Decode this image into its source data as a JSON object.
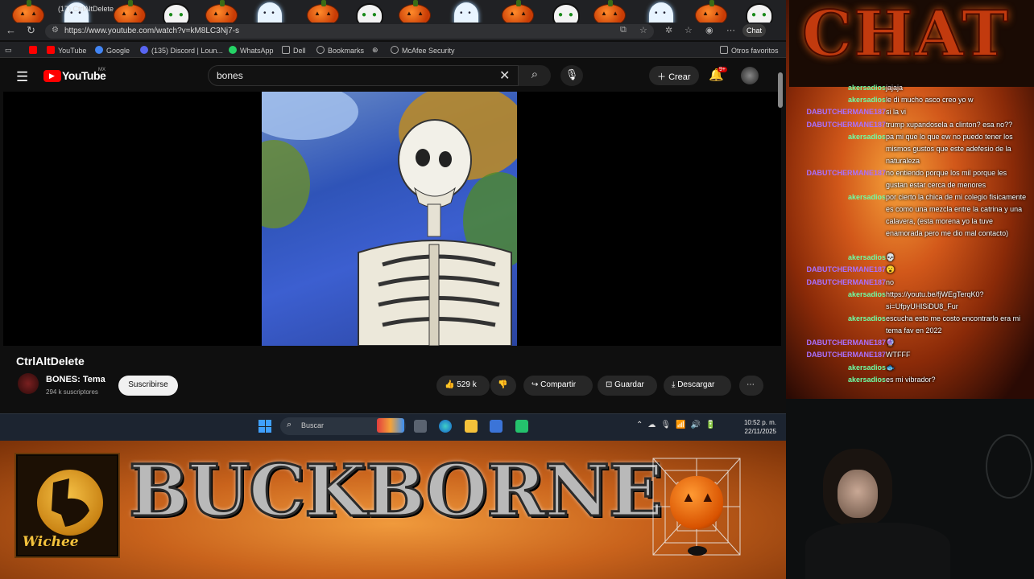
{
  "browser": {
    "tab_title": "(17) CtrlAltDelete",
    "url": "https://www.youtube.com/watch?v=kM8LC3Nj7-s",
    "chat_button": "Chat",
    "bookmarks": [
      {
        "label": "YouTube",
        "color": "#ff0000"
      },
      {
        "label": "Google",
        "color": "#4285f4"
      },
      {
        "label": "(135) Discord | Loun...",
        "color": "#5865f2"
      },
      {
        "label": "WhatsApp",
        "color": "#25d366"
      },
      {
        "label": "Dell",
        "color": "#888888"
      },
      {
        "label": "Bookmarks",
        "color": "#888888"
      },
      {
        "label": "McAfee Security",
        "color": "#888888"
      }
    ],
    "other_favorites": "Otros favoritos"
  },
  "youtube": {
    "logo_text": "YouTube",
    "region": "MX",
    "search_value": "bones",
    "create_label": "Crear",
    "notif_count": "9+",
    "video_title": "CtrlAltDelete",
    "channel_name": "BONES: Tema",
    "channel_subs": "294 k suscriptores",
    "subscribe_label": "Suscribirse",
    "likes": "529 k",
    "share_label": "Compartir",
    "save_label": "Guardar",
    "download_label": "Descargar"
  },
  "taskbar": {
    "search_placeholder": "Buscar",
    "time": "10:52 p. m.",
    "date": "22/11/2025"
  },
  "banner": {
    "logo_label": "Wichee",
    "title": "BUCKBORNE"
  },
  "chat": {
    "header": "CHAT",
    "messages": [
      {
        "user": "akersadios",
        "text": "jajaja",
        "color": "green"
      },
      {
        "user": "akersadios",
        "text": "le di mucho asco creo yo w",
        "color": "green"
      },
      {
        "user": "DABUTCHERMANE187",
        "text": "si la vi",
        "color": "purple"
      },
      {
        "user": "DABUTCHERMANE187",
        "text": "trump xupandosela a clinton? esa no??",
        "color": "purple"
      },
      {
        "user": "akersadios",
        "text": "pa mi que lo que ew no puedo tener los mismos gustos que este adefesio de la naturaleza",
        "color": "green"
      },
      {
        "user": "DABUTCHERMANE187",
        "text": "no entiendo porque los mil porque les gustan estar cerca de menores",
        "color": "purple"
      },
      {
        "user": "akersadios",
        "text": "por cierto la chica de mi colegio fisicamente es como una mezcla entre la catrina y una calavera, (esta morena yo la tuve enamorada pero me dio mal contacto)",
        "color": "green"
      },
      {
        "user": "akersadios",
        "text": "💀",
        "color": "green"
      },
      {
        "user": "DABUTCHERMANE187",
        "text": "😮",
        "color": "purple"
      },
      {
        "user": "DABUTCHERMANE187",
        "text": "no",
        "color": "purple"
      },
      {
        "user": "akersadios",
        "text": "https://youtu.be/fjWEgTerqK0?si=UfpyUHlSiDU8_Fur",
        "color": "green"
      },
      {
        "user": "akersadios",
        "text": "escucha esto me costo encontrarlo era mi tema fav en 2022",
        "color": "green"
      },
      {
        "user": "DABUTCHERMANE187",
        "text": "🔮",
        "color": "purple"
      },
      {
        "user": "DABUTCHERMANE187",
        "text": "WTFFF",
        "color": "purple"
      },
      {
        "user": "akersadios",
        "text": "🐟",
        "color": "green"
      },
      {
        "user": "akersadios",
        "text": "es mi vibrador?",
        "color": "green"
      }
    ]
  }
}
